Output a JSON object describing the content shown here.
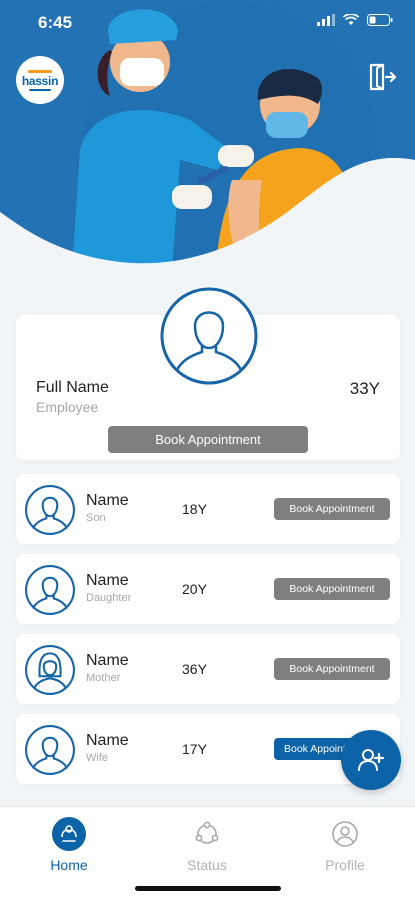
{
  "status_bar": {
    "time": "6:45"
  },
  "brand": {
    "logo_text": "hassin"
  },
  "main_profile": {
    "full_name": "Full Name",
    "role": "Employee",
    "age": "33Y",
    "book_label": "Book Appointment"
  },
  "members": [
    {
      "name": "Name",
      "relation": "Son",
      "age": "18Y",
      "book_label": "Book Appointment",
      "avatar": "male-avatar-icon"
    },
    {
      "name": "Name",
      "relation": "Daughter",
      "age": "20Y",
      "book_label": "Book Appointment",
      "avatar": "male-avatar-icon"
    },
    {
      "name": "Name",
      "relation": "Mother",
      "age": "36Y",
      "book_label": "Book Appointment",
      "avatar": "female-avatar-icon"
    },
    {
      "name": "Name",
      "relation": "Wife",
      "age": "17Y",
      "book_label": "Book Appointment",
      "avatar": "male-avatar-icon"
    }
  ],
  "tabs": [
    {
      "label": "Home",
      "icon": "home-vaccine-icon",
      "active": true
    },
    {
      "label": "Status",
      "icon": "status-cycle-icon",
      "active": false
    },
    {
      "label": "Profile",
      "icon": "profile-icon",
      "active": false
    }
  ],
  "colors": {
    "primary": "#0d63a8",
    "button_gray": "#7f7f7f",
    "background": "#f2f5f8"
  }
}
